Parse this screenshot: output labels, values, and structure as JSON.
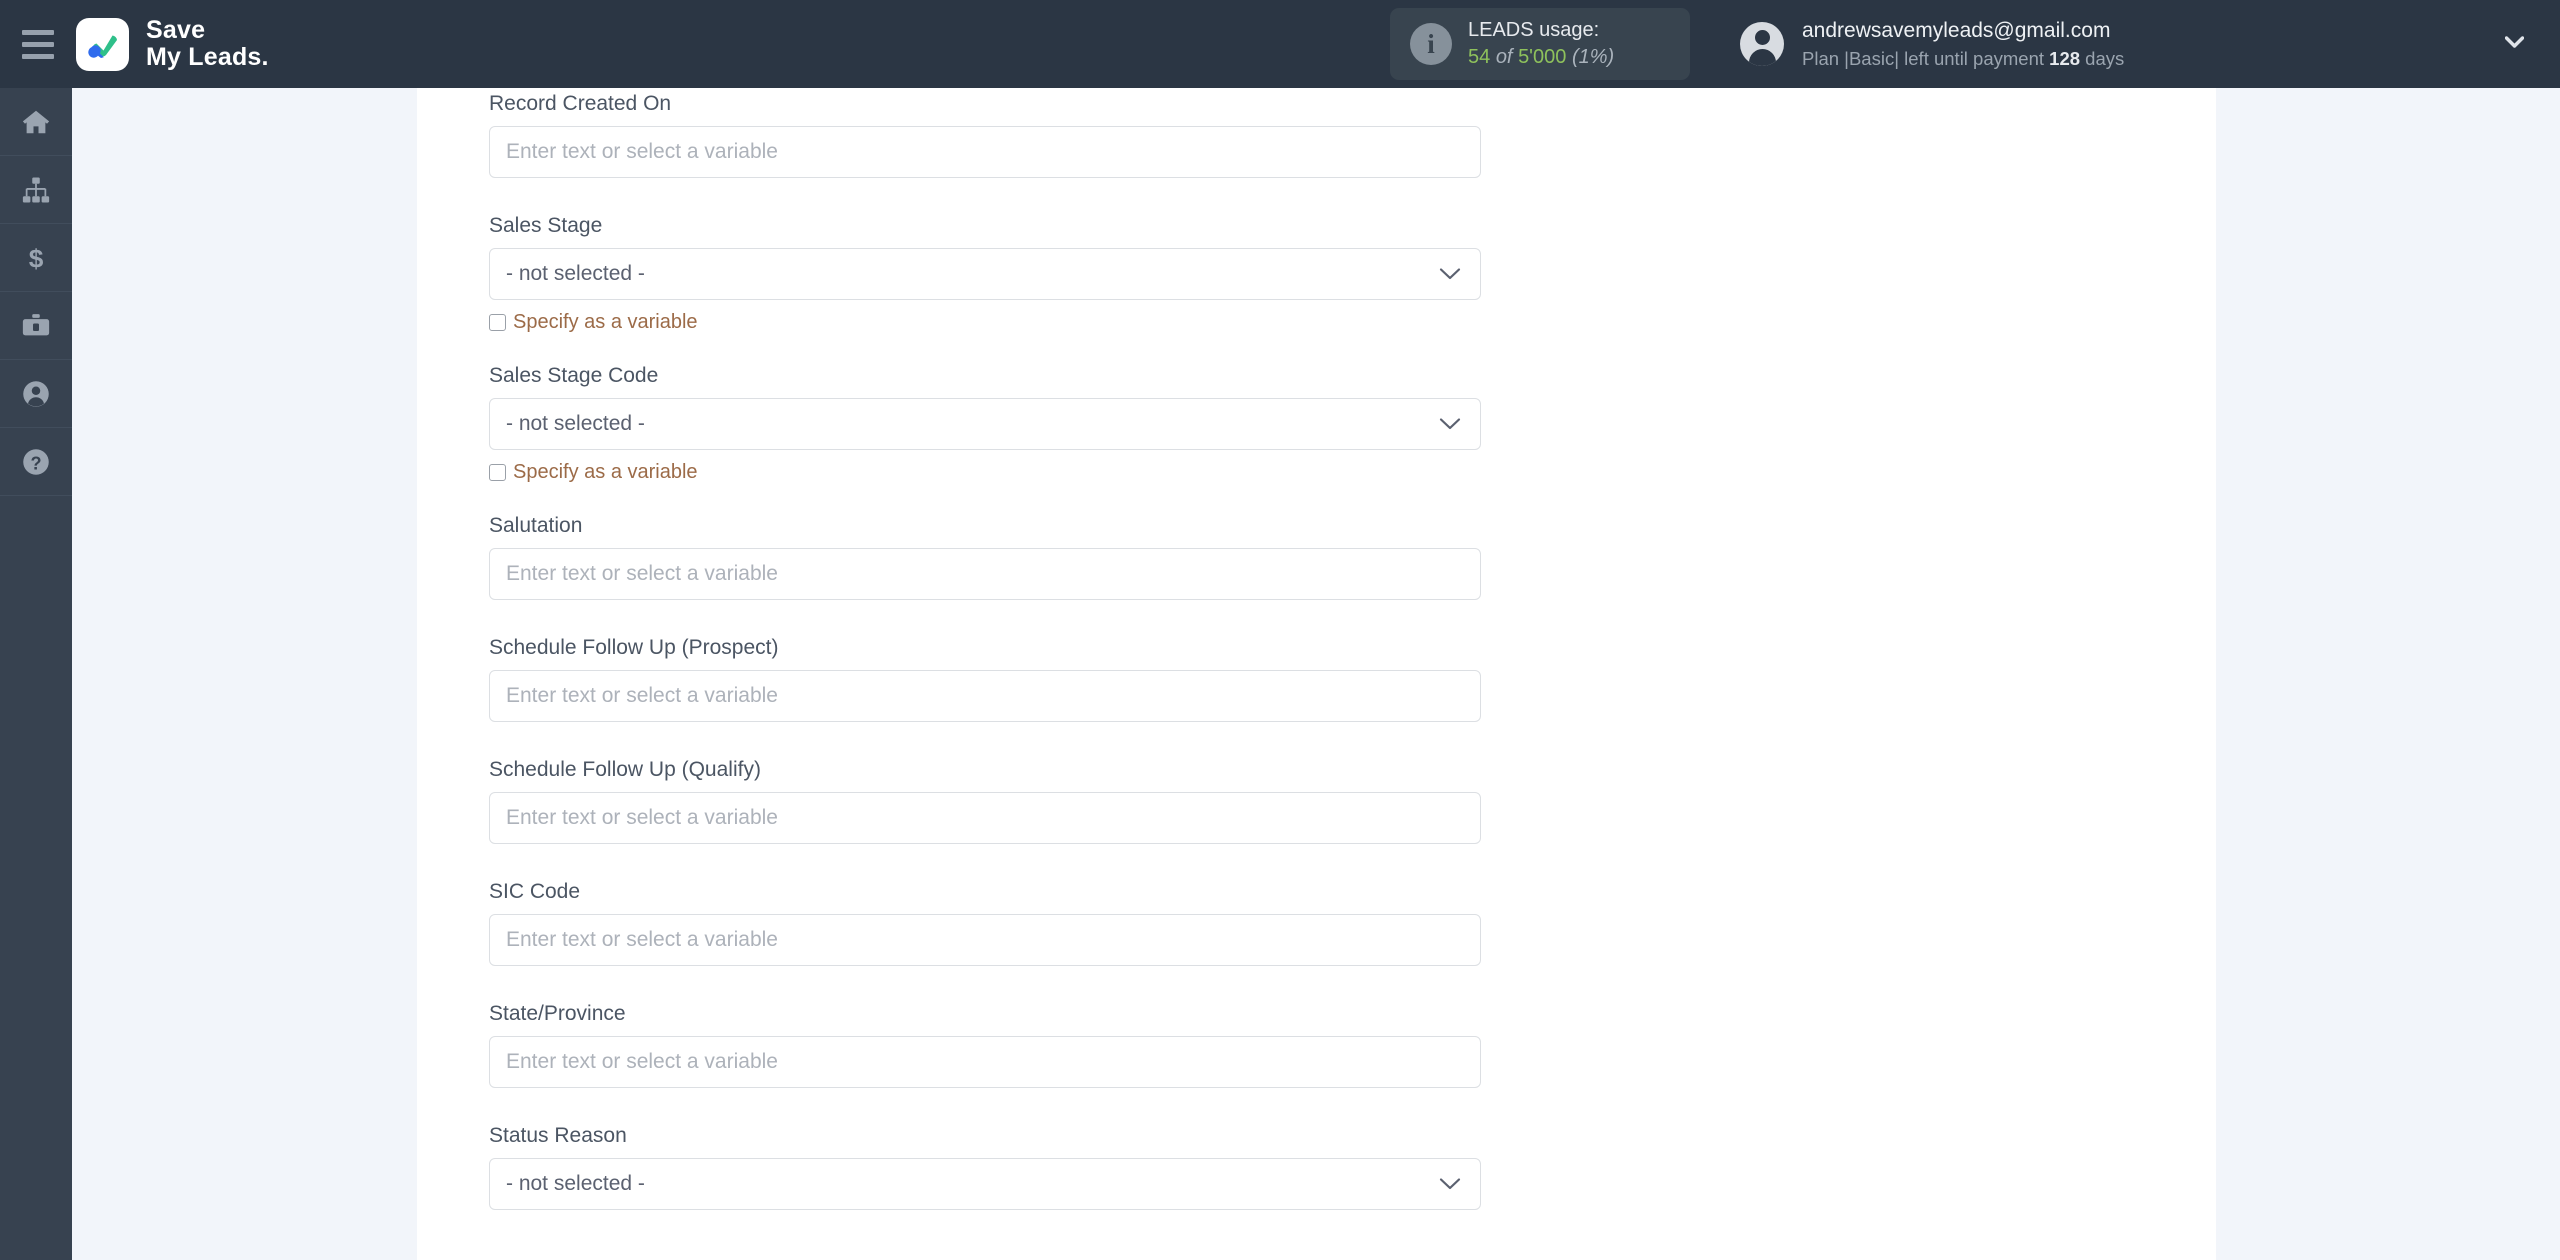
{
  "header": {
    "menu_icon": "hamburger-icon",
    "brand_line1": "Save",
    "brand_line2": "My Leads.",
    "usage": {
      "icon": "info-icon",
      "title": "LEADS usage:",
      "used": "54",
      "of": "of",
      "total": "5'000",
      "percent": "(1%)"
    },
    "account": {
      "avatar_icon": "user-avatar-icon",
      "email": "andrewsavemyleads@gmail.com",
      "plan_prefix": "Plan |Basic| left until payment",
      "plan_days": "128",
      "plan_suffix": "days",
      "caret_icon": "chevron-down-icon"
    }
  },
  "sidebar": {
    "items": [
      {
        "icon": "home-icon",
        "label": "Home"
      },
      {
        "icon": "sitemap-icon",
        "label": "Connections"
      },
      {
        "icon": "dollar-icon",
        "label": "Billing"
      },
      {
        "icon": "briefcase-icon",
        "label": "Business"
      },
      {
        "icon": "user-icon",
        "label": "Account"
      },
      {
        "icon": "help-icon",
        "label": "Help"
      }
    ]
  },
  "colors": {
    "topbar": "#2b3644",
    "sidebar": "#374250",
    "page_bg": "#f2f5fa",
    "panel": "#ffffff",
    "accent_green": "#8ec15c",
    "checkbox_label": "#9c6b48"
  },
  "form": {
    "placeholder": "Enter text or select a variable",
    "not_selected": "- not selected -",
    "specify_variable": "Specify as a variable",
    "fields": [
      {
        "label": "Record Created On",
        "type": "text",
        "value": "",
        "checkbox": false
      },
      {
        "label": "Sales Stage",
        "type": "select",
        "value": "- not selected -",
        "checkbox": true
      },
      {
        "label": "Sales Stage Code",
        "type": "select",
        "value": "- not selected -",
        "checkbox": true
      },
      {
        "label": "Salutation",
        "type": "text",
        "value": "",
        "checkbox": false
      },
      {
        "label": "Schedule Follow Up (Prospect)",
        "type": "text",
        "value": "",
        "checkbox": false
      },
      {
        "label": "Schedule Follow Up (Qualify)",
        "type": "text",
        "value": "",
        "checkbox": false
      },
      {
        "label": "SIC Code",
        "type": "text",
        "value": "",
        "checkbox": false
      },
      {
        "label": "State/Province",
        "type": "text",
        "value": "",
        "checkbox": false
      },
      {
        "label": "Status Reason",
        "type": "select",
        "value": "- not selected -",
        "checkbox": false
      }
    ]
  }
}
